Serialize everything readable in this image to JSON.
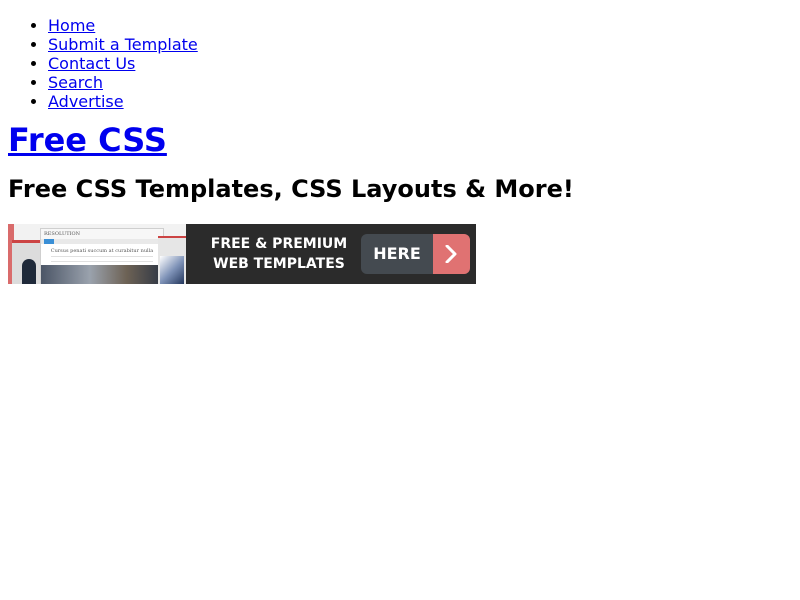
{
  "nav": {
    "items": [
      {
        "label": "Home"
      },
      {
        "label": "Submit a Template"
      },
      {
        "label": "Contact Us"
      },
      {
        "label": "Search"
      },
      {
        "label": "Advertise"
      }
    ]
  },
  "header": {
    "site_title": "Free CSS",
    "tagline": "Free CSS Templates, CSS Layouts & More!"
  },
  "banner": {
    "preview_brand": "RESOLUTION",
    "preview_headline": "Cursus penati succum at curabitur nulla",
    "text_line1": "FREE & PREMIUM",
    "text_line2": "WEB TEMPLATES",
    "button_label": "HERE",
    "button_icon": "chevron-right-icon",
    "colors": {
      "background": "#2b2b2b",
      "button": "#444a50",
      "accent": "#e07272"
    }
  },
  "colors": {
    "link": "#0000ee",
    "text": "#000000",
    "background": "#ffffff"
  }
}
